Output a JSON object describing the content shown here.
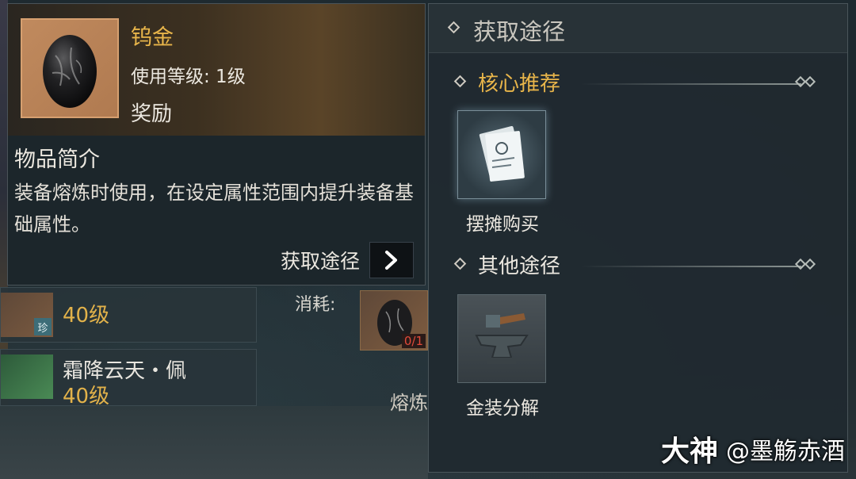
{
  "item": {
    "name": "钨金",
    "level": "使用等级: 1级",
    "type": "奖励",
    "icon": "black-egg-icon",
    "description_title": "物品简介",
    "description": "装备熔炼时使用，在设定属性范围内提升装备基础属性。",
    "source_link_label": "获取途径"
  },
  "acquisition": {
    "title": "获取途径",
    "core": {
      "title": "核心推荐",
      "items": [
        {
          "label": "摆摊购买",
          "icon": "stall-note-icon"
        }
      ]
    },
    "other": {
      "title": "其他途径",
      "items": [
        {
          "label": "金装分解",
          "icon": "anvil-icon"
        }
      ]
    }
  },
  "background": {
    "cards": [
      {
        "level": "40级",
        "rarity": "珍"
      },
      {
        "name": "霜降云天・佩",
        "level": "40级"
      }
    ],
    "consume_label": "消耗:",
    "consume_count": "0/1",
    "smelt_label": "熔炼"
  },
  "watermark": {
    "logo": "大神",
    "user": "@墨觞赤酒"
  },
  "colors": {
    "gold": "#e8b54a",
    "text": "#ece8e0",
    "panel": "#202a30"
  }
}
